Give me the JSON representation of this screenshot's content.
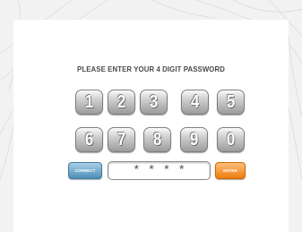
{
  "prompt": "PLEASE ENTER YOUR 4 DIGIT PASSWORD",
  "keys": [
    "1",
    "2",
    "3",
    "4",
    "5",
    "6",
    "7",
    "8",
    "9",
    "0"
  ],
  "correct_label": "CORRECT",
  "enter_label": "ENTER",
  "password_mask": "* * * *",
  "colors": {
    "correct": "#4e8fb7",
    "enter": "#ee7d10",
    "key": "#9b9b9b"
  }
}
